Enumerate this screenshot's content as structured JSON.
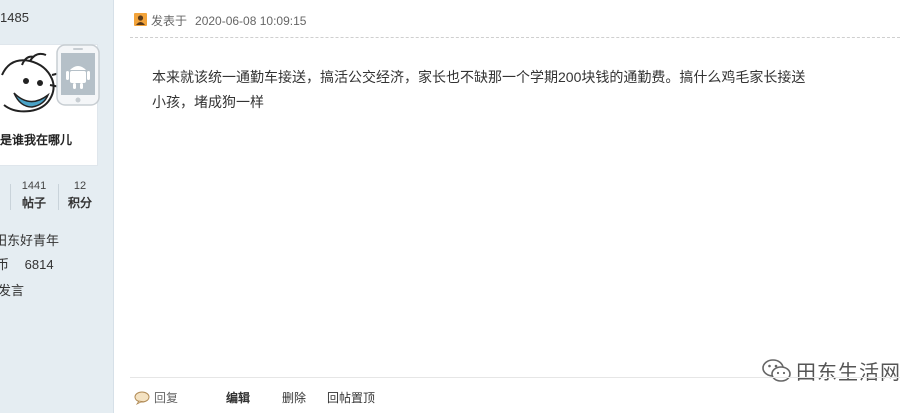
{
  "user": {
    "uid": "1485",
    "avatar_caption": "是谁我在哪儿",
    "stats": [
      {
        "value": "",
        "label": ""
      },
      {
        "value": "1441",
        "label": "帖子"
      },
      {
        "value": "12",
        "label": "积分"
      }
    ],
    "group": "田东好青年",
    "coins_label": "币",
    "coins_value": "6814",
    "send_message": "发言"
  },
  "post": {
    "meta_label": "发表于",
    "timestamp": "2020-06-08 10:09:15",
    "body_line1": "本来就该统一通勤车接送，搞活公交经济，家长也不缺那一个学期200块钱的通勤费。搞什么鸡毛家长接送",
    "body_line2": "小孩，堵成狗一样",
    "watermark": "田东生活网"
  },
  "footer": {
    "reply": "回复",
    "edit": "编辑",
    "delete": "删除",
    "pin": "回帖置顶"
  },
  "icons": {
    "post_icon": "post-author-icon",
    "reply_icon": "reply-bubble-icon",
    "wechat_icon": "wechat-icon",
    "android_icon": "android-phone-icon"
  },
  "colors": {
    "sidebar_bg": "#e5edf2",
    "post_icon": "#e0701a"
  }
}
